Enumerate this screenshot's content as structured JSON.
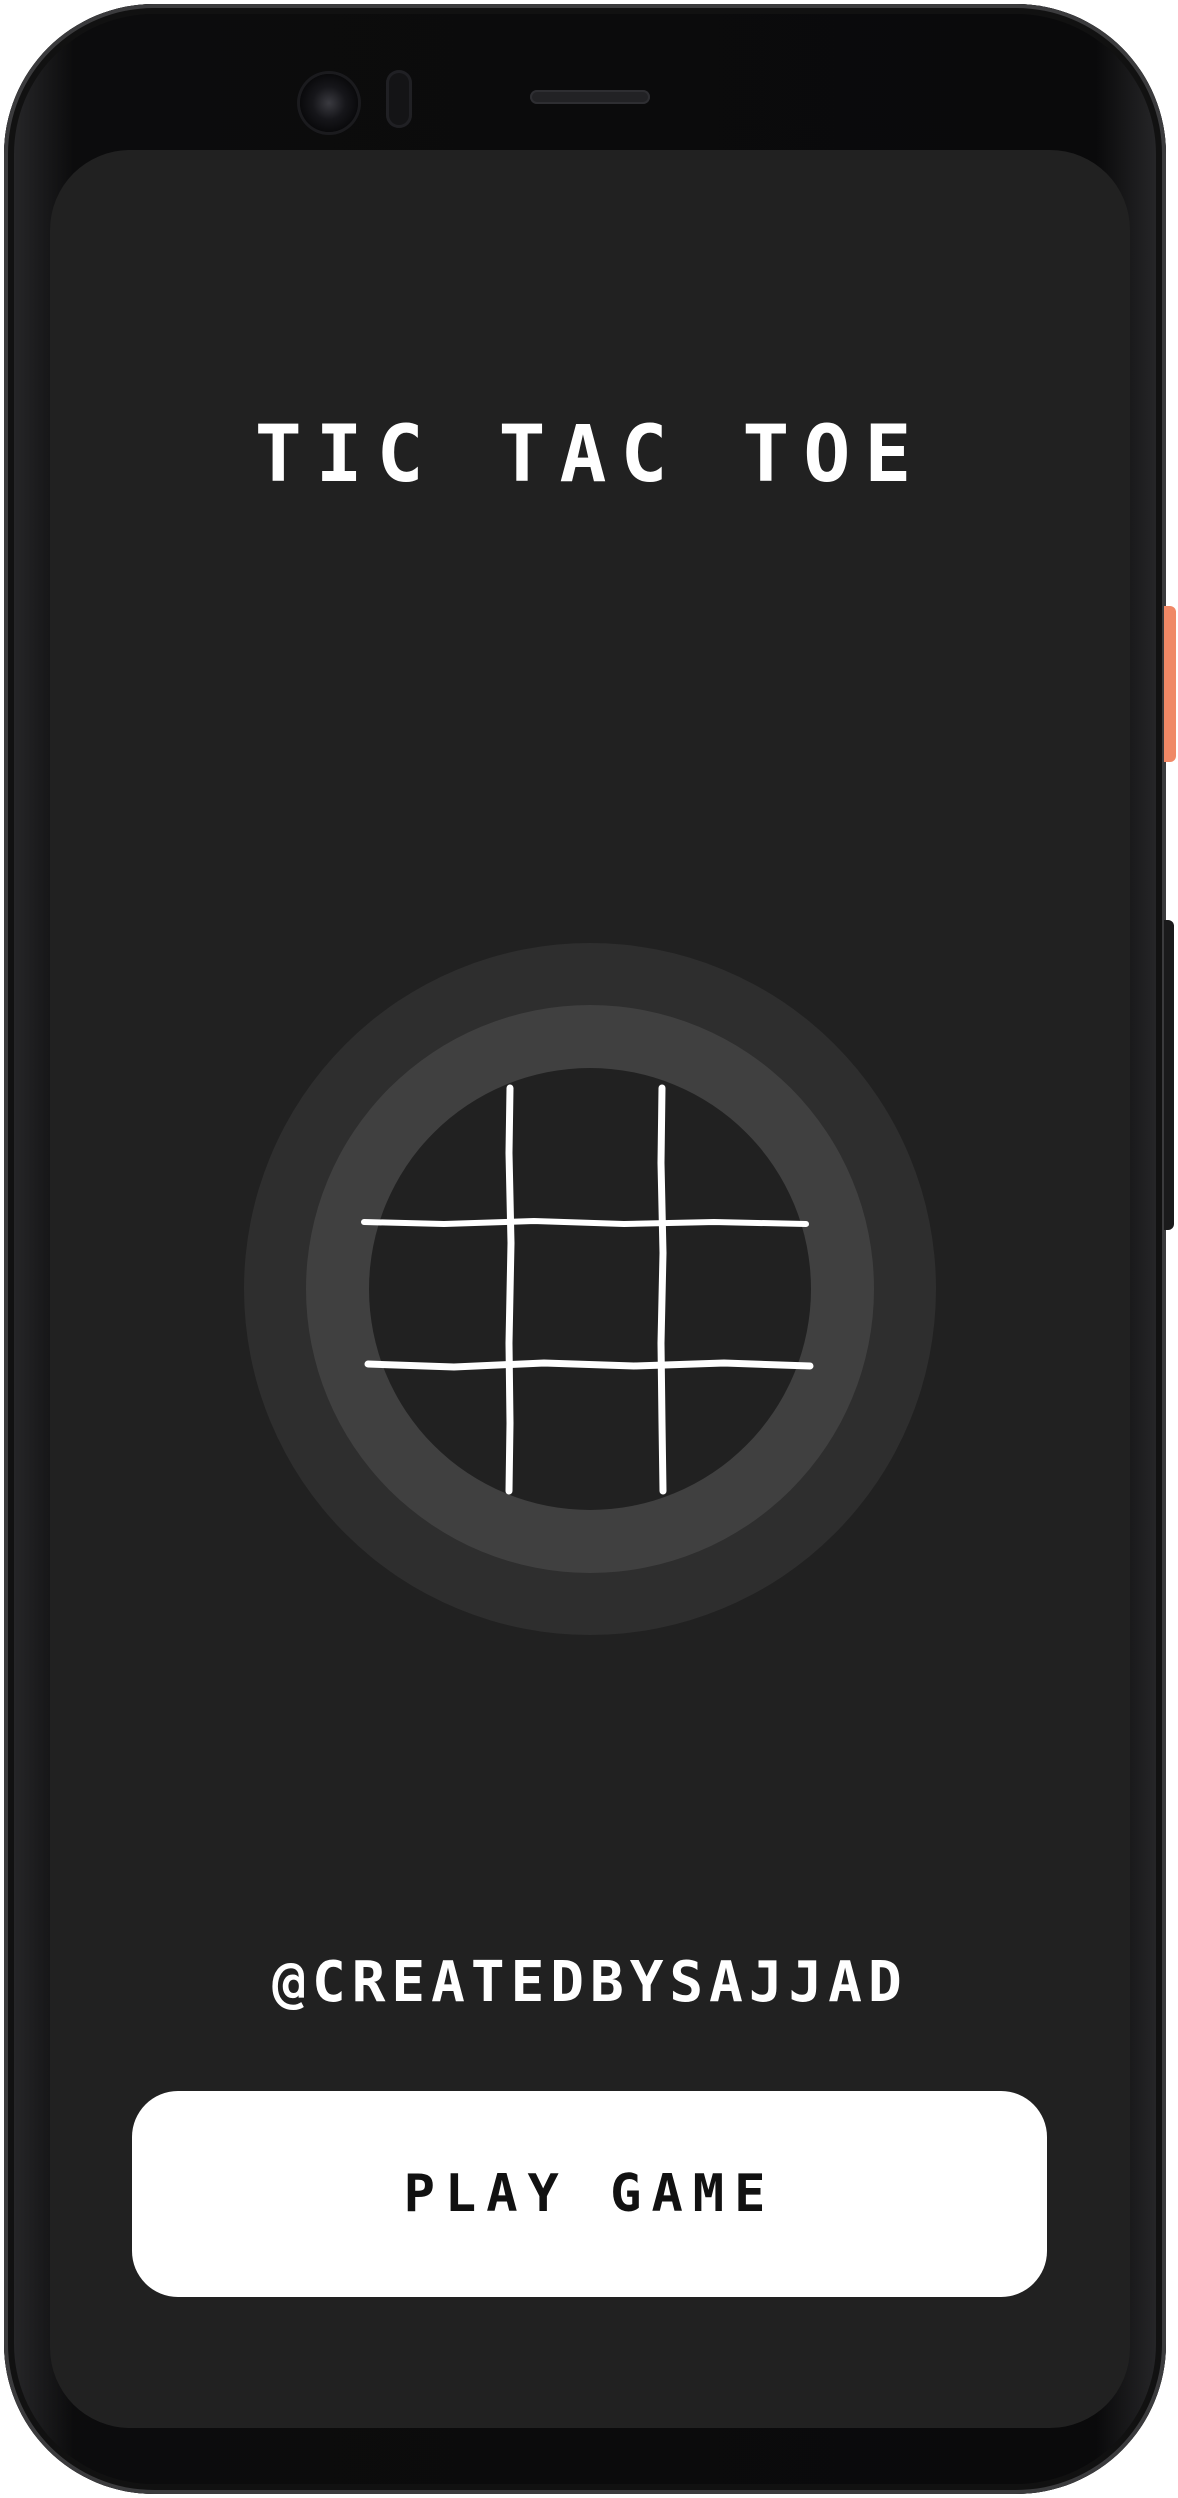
{
  "app": {
    "title": "TIC TAC TOE",
    "credit": "@CREATEDBYSAJJAD",
    "play_button_label": "PLAY GAME"
  },
  "board": {
    "icon": "tic-tac-toe-grid-icon",
    "rows": 3,
    "cols": 3
  },
  "colors": {
    "screen_background": "#212121",
    "ring_outer": "#2e2e2e",
    "ring_middle": "#404040",
    "text": "#ffffff",
    "button_background": "#ffffff",
    "button_text": "#111111",
    "power_key": "#f08866"
  }
}
